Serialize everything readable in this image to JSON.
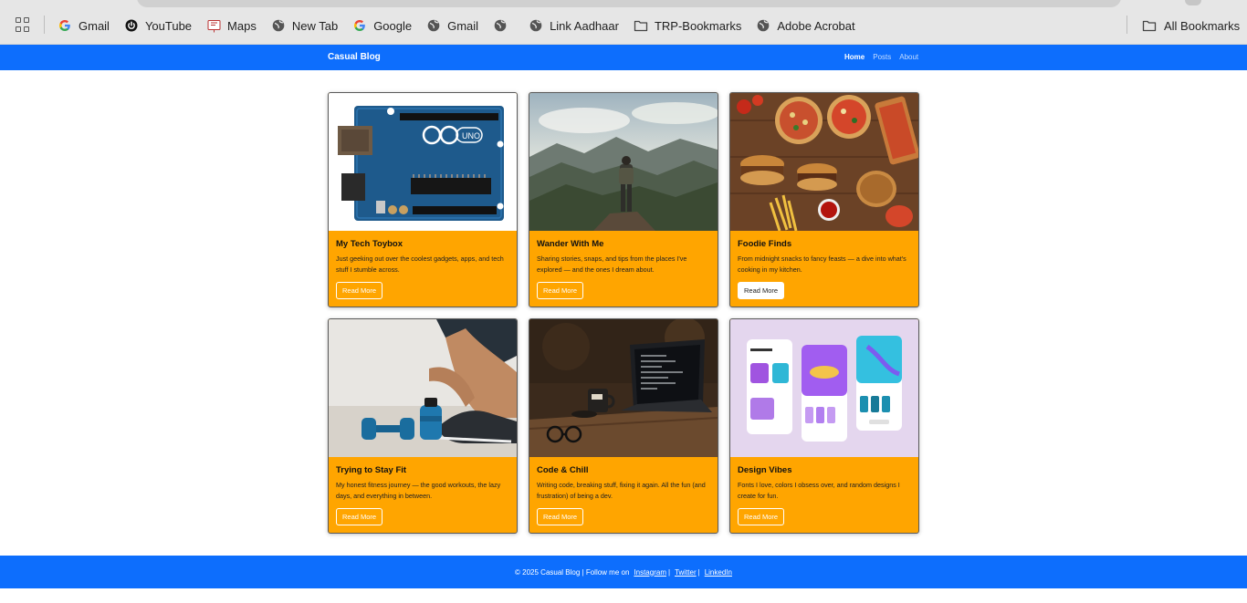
{
  "bookmarks": {
    "items": [
      {
        "label": "Gmail",
        "icon": "google-icon"
      },
      {
        "label": "YouTube",
        "icon": "power-icon"
      },
      {
        "label": "Maps",
        "icon": "maps-icon"
      },
      {
        "label": "New Tab",
        "icon": "globe-icon"
      },
      {
        "label": "Google",
        "icon": "google-icon"
      },
      {
        "label": "Gmail",
        "icon": "globe-icon"
      },
      {
        "label": "",
        "icon": "globe-icon"
      },
      {
        "label": "Link Aadhaar",
        "icon": "globe-icon"
      },
      {
        "label": "TRP-Bookmarks",
        "icon": "folder-icon"
      },
      {
        "label": "Adobe Acrobat",
        "icon": "globe-icon"
      }
    ],
    "all_bookmarks": "All Bookmarks"
  },
  "site": {
    "brand": "Casual Blog",
    "nav": [
      "Home",
      "Posts",
      "About"
    ],
    "active_nav": "Home",
    "accent_color": "#0d6efd",
    "card_color": "#ffa500"
  },
  "cards": [
    {
      "title": "My Tech Toybox",
      "text": "Just geeking out over the coolest gadgets, apps, and tech stuff I stumble across.",
      "button": "Read More",
      "image": "arduino-board-image"
    },
    {
      "title": "Wander With Me",
      "text": "Sharing stories, snaps, and tips from the places I've explored — and the ones I dream about.",
      "button": "Read More",
      "image": "mountain-hiker-image"
    },
    {
      "title": "Foodie Finds",
      "text": "From midnight snacks to fancy feasts — a dive into what's cooking in my kitchen.",
      "button": "Read More",
      "image": "food-spread-image"
    },
    {
      "title": "Trying to Stay Fit",
      "text": "My honest fitness journey — the good workouts, the lazy days, and everything in between.",
      "button": "Read More",
      "image": "fitness-dumbbells-image"
    },
    {
      "title": "Code & Chill",
      "text": "Writing code, breaking stuff, fixing it again. All the fun (and frustration) of being a dev.",
      "button": "Read More",
      "image": "laptop-coffee-image"
    },
    {
      "title": "Design Vibes",
      "text": "Fonts I love, colors I obsess over, and random designs I create for fun.",
      "button": "Read More",
      "image": "app-design-mockup-image"
    }
  ],
  "footer": {
    "text": "© 2025 Casual Blog | Follow me on",
    "links": [
      "Instagram",
      "Twitter",
      "LinkedIn"
    ],
    "separator": "|"
  }
}
